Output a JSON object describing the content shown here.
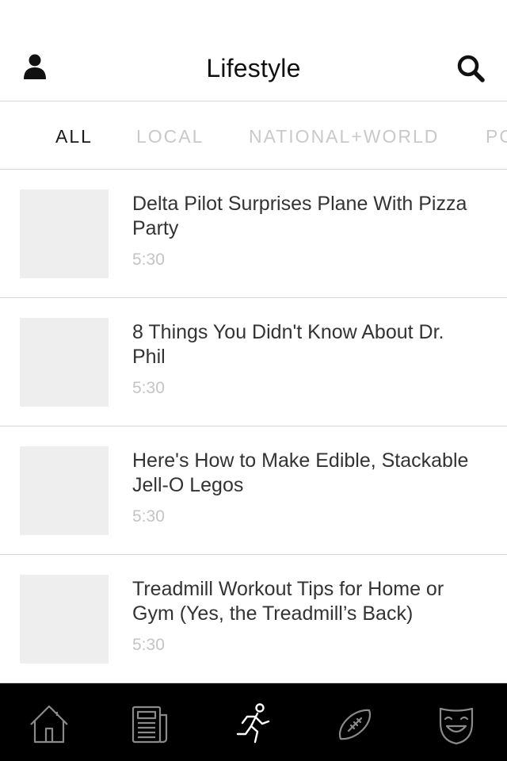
{
  "header": {
    "title": "Lifestyle",
    "user_icon": "user-icon",
    "search_icon": "search-icon"
  },
  "tabs": [
    {
      "label": "ALL",
      "active": true
    },
    {
      "label": "LOCAL",
      "active": false
    },
    {
      "label": "NATIONAL+WORLD",
      "active": false
    },
    {
      "label": "PO",
      "active": false
    }
  ],
  "articles": [
    {
      "title": "Delta Pilot Surprises Plane With Pizza Party",
      "duration": "5:30"
    },
    {
      "title": "8 Things You Didn't Know About Dr. Phil",
      "duration": "5:30"
    },
    {
      "title": "Here's How to Make Edible, Stackable Jell-O Legos",
      "duration": "5:30"
    },
    {
      "title": "Treadmill Workout Tips for Home or Gym (Yes, the Treadmill’s Back)",
      "duration": "5:30"
    }
  ],
  "tabbar": [
    {
      "icon": "home-icon",
      "active": false
    },
    {
      "icon": "newspaper-icon",
      "active": false
    },
    {
      "icon": "runner-icon",
      "active": true
    },
    {
      "icon": "football-icon",
      "active": false
    },
    {
      "icon": "theater-mask-icon",
      "active": false
    }
  ],
  "colors": {
    "background": "#ffffff",
    "tabbar_background": "#000000",
    "tab_active": "#1a1a1a",
    "tab_inactive": "#c9c9c9",
    "thumbnail_placeholder": "#eeeeee",
    "divider": "#d6d6d6",
    "icon_active": "#ffffff",
    "icon_inactive": "#8a8a8a"
  }
}
